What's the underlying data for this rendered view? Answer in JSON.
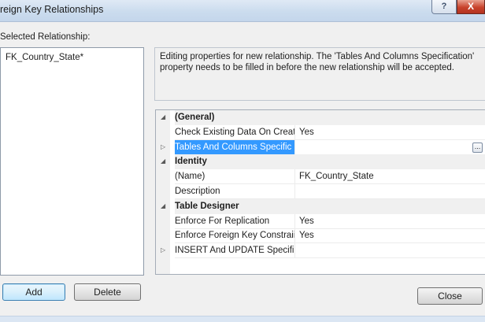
{
  "window": {
    "title": "reign Key Relationships",
    "help_label": "?",
    "close_label": "X"
  },
  "relationships": {
    "label": "Selected Relationship:",
    "items": [
      {
        "label": "FK_Country_State*"
      }
    ]
  },
  "info": {
    "text": "Editing properties for new relationship.  The 'Tables And Columns Specification' property needs to be filled in before the new relationship will be accepted."
  },
  "properties": {
    "rows": [
      {
        "kind": "category",
        "expander": "◢",
        "name": "(General)",
        "value": ""
      },
      {
        "kind": "property",
        "expander": "",
        "name": "Check Existing Data On Creati",
        "value": "Yes"
      },
      {
        "kind": "property",
        "expander": "▷",
        "name": "Tables And Columns Specific",
        "value": "",
        "selected": true,
        "ellipsis": "..."
      },
      {
        "kind": "category",
        "expander": "◢",
        "name": "Identity",
        "value": ""
      },
      {
        "kind": "property",
        "expander": "",
        "name": "(Name)",
        "value": "FK_Country_State"
      },
      {
        "kind": "property",
        "expander": "",
        "name": "Description",
        "value": ""
      },
      {
        "kind": "category",
        "expander": "◢",
        "name": "Table Designer",
        "value": ""
      },
      {
        "kind": "property",
        "expander": "",
        "name": "Enforce For Replication",
        "value": "Yes"
      },
      {
        "kind": "property",
        "expander": "",
        "name": "Enforce Foreign Key Constraii",
        "value": "Yes"
      },
      {
        "kind": "property",
        "expander": "▷",
        "name": "INSERT And UPDATE Specific",
        "value": ""
      }
    ]
  },
  "buttons": {
    "add": "Add",
    "delete": "Delete",
    "close": "Close"
  },
  "colors": {
    "selection": "#3399ff",
    "dialog_bg": "#f0f0f0",
    "titlebar": "#cbdcee",
    "close_button": "#c8432c"
  }
}
